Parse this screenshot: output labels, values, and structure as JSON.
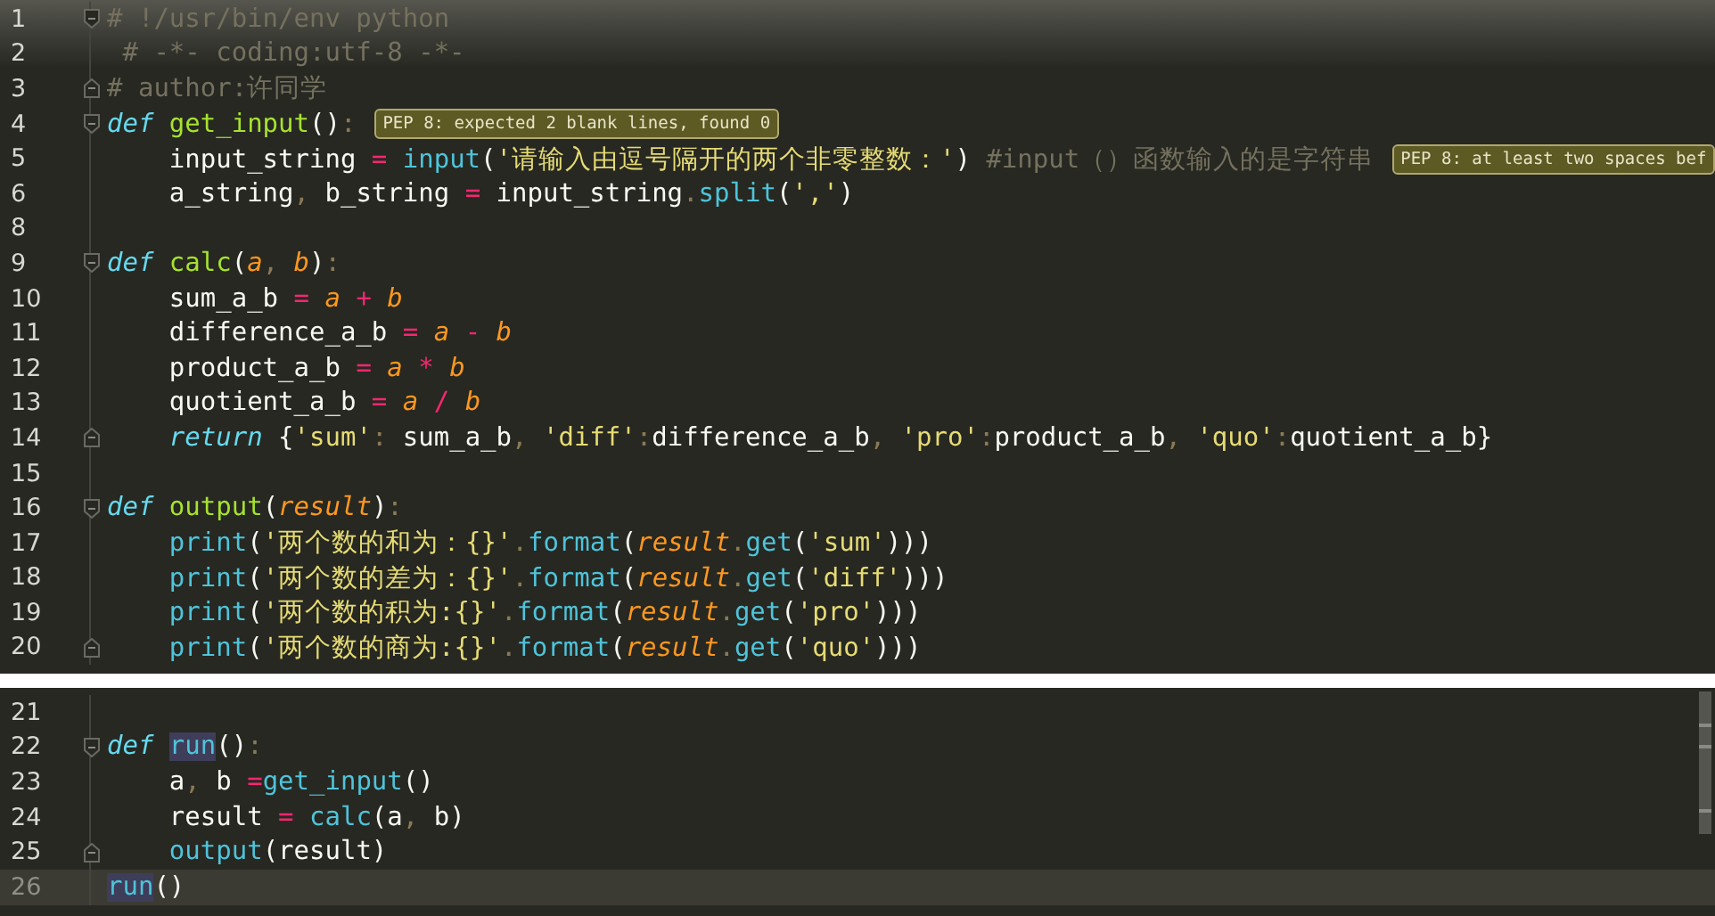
{
  "panels": [
    {
      "lines": [
        {
          "number": "1",
          "fold_marker": {
            "kind": "open"
          },
          "current": false,
          "tokens": [
            {
              "t": "# !/usr/bin/env python",
              "kind": "c"
            }
          ]
        },
        {
          "number": "2",
          "current": false,
          "tokens": [
            {
              "t": " # -*- coding:utf-8 -*-",
              "kind": "c"
            }
          ]
        },
        {
          "number": "3",
          "fold_marker": {
            "kind": "close"
          },
          "current": false,
          "tokens": [
            {
              "t": "# author:许同学",
              "kind": "c"
            }
          ]
        },
        {
          "number": "4",
          "fold_marker": {
            "kind": "open"
          },
          "current": false,
          "tokens": [
            {
              "t": "def ",
              "kind": "kw"
            },
            {
              "t": "get_input",
              "kind": "fn"
            },
            {
              "t": "()",
              "kind": "x"
            },
            {
              "t": ":",
              "kind": "p"
            }
          ],
          "hint": "PEP 8: expected 2 blank lines, found 0"
        },
        {
          "number": "5",
          "current": false,
          "tokens": [
            {
              "t": "    input_string ",
              "kind": "x"
            },
            {
              "t": "= ",
              "kind": "op"
            },
            {
              "t": "input",
              "kind": "call"
            },
            {
              "t": "(",
              "kind": "x"
            },
            {
              "t": "'请输入由逗号隔开的两个非零整数：'",
              "kind": "str"
            },
            {
              "t": ") ",
              "kind": "x"
            },
            {
              "t": "#input（）函数输入的是字符串",
              "kind": "c"
            }
          ],
          "hint": "PEP 8: at least two spaces bef"
        },
        {
          "number": "6",
          "current": false,
          "tokens": [
            {
              "t": "    a_string",
              "kind": "x"
            },
            {
              "t": ",",
              "kind": "p"
            },
            {
              "t": " b_string ",
              "kind": "x"
            },
            {
              "t": "=",
              "kind": "op"
            },
            {
              "t": " input_string",
              "kind": "x"
            },
            {
              "t": ".",
              "kind": "p"
            },
            {
              "t": "split",
              "kind": "call"
            },
            {
              "t": "(",
              "kind": "x"
            },
            {
              "t": "','",
              "kind": "str"
            },
            {
              "t": ")",
              "kind": "x"
            }
          ]
        },
        {
          "number": "8",
          "current": false
        },
        {
          "number": "9",
          "fold_marker": {
            "kind": "open"
          },
          "current": false,
          "tokens": [
            {
              "t": "def ",
              "kind": "kw"
            },
            {
              "t": "calc",
              "kind": "fn"
            },
            {
              "t": "(",
              "kind": "x"
            },
            {
              "t": "a",
              "kind": "par"
            },
            {
              "t": ", ",
              "kind": "p"
            },
            {
              "t": "b",
              "kind": "par"
            },
            {
              "t": ")",
              "kind": "x"
            },
            {
              "t": ":",
              "kind": "p"
            }
          ]
        },
        {
          "number": "10",
          "current": false,
          "tokens": [
            {
              "t": "    sum_a_b ",
              "kind": "x"
            },
            {
              "t": "= ",
              "kind": "op"
            },
            {
              "t": "a ",
              "kind": "par"
            },
            {
              "t": "+ ",
              "kind": "op"
            },
            {
              "t": "b",
              "kind": "par"
            }
          ]
        },
        {
          "number": "11",
          "current": false,
          "tokens": [
            {
              "t": "    difference_a_b ",
              "kind": "x"
            },
            {
              "t": "= ",
              "kind": "op"
            },
            {
              "t": "a ",
              "kind": "par"
            },
            {
              "t": "- ",
              "kind": "op"
            },
            {
              "t": "b",
              "kind": "par"
            }
          ]
        },
        {
          "number": "12",
          "current": false,
          "tokens": [
            {
              "t": "    product_a_b ",
              "kind": "x"
            },
            {
              "t": "= ",
              "kind": "op"
            },
            {
              "t": "a ",
              "kind": "par"
            },
            {
              "t": "* ",
              "kind": "op"
            },
            {
              "t": "b",
              "kind": "par"
            }
          ]
        },
        {
          "number": "13",
          "current": false,
          "tokens": [
            {
              "t": "    quotient_a_b ",
              "kind": "x"
            },
            {
              "t": "= ",
              "kind": "op"
            },
            {
              "t": "a ",
              "kind": "par"
            },
            {
              "t": "/ ",
              "kind": "op"
            },
            {
              "t": "b",
              "kind": "par"
            }
          ]
        },
        {
          "number": "14",
          "fold_marker": {
            "kind": "close"
          },
          "current": false,
          "tokens": [
            {
              "t": "    return",
              "kind": "kw"
            },
            {
              "t": " {",
              "kind": "x"
            },
            {
              "t": "'sum'",
              "kind": "str"
            },
            {
              "t": ":",
              "kind": "p"
            },
            {
              "t": " sum_a_b",
              "kind": "x"
            },
            {
              "t": ", ",
              "kind": "p"
            },
            {
              "t": "'diff'",
              "kind": "str"
            },
            {
              "t": ":",
              "kind": "p"
            },
            {
              "t": "difference_a_b",
              "kind": "x"
            },
            {
              "t": ", ",
              "kind": "p"
            },
            {
              "t": "'pro'",
              "kind": "str"
            },
            {
              "t": ":",
              "kind": "p"
            },
            {
              "t": "product_a_b",
              "kind": "x"
            },
            {
              "t": ", ",
              "kind": "p"
            },
            {
              "t": "'quo'",
              "kind": "str"
            },
            {
              "t": ":",
              "kind": "p"
            },
            {
              "t": "quotient_a_b}",
              "kind": "x"
            }
          ]
        },
        {
          "number": "15",
          "current": false
        },
        {
          "number": "16",
          "fold_marker": {
            "kind": "open"
          },
          "current": false,
          "tokens": [
            {
              "t": "def ",
              "kind": "kw"
            },
            {
              "t": "output",
              "kind": "fn"
            },
            {
              "t": "(",
              "kind": "x"
            },
            {
              "t": "result",
              "kind": "par"
            },
            {
              "t": ")",
              "kind": "x"
            },
            {
              "t": ":",
              "kind": "p"
            }
          ]
        },
        {
          "number": "17",
          "current": false,
          "tokens": [
            {
              "t": "    print",
              "kind": "call"
            },
            {
              "t": "(",
              "kind": "x"
            },
            {
              "t": "'两个数的和为：{}'",
              "kind": "str"
            },
            {
              "t": ".",
              "kind": "p"
            },
            {
              "t": "format",
              "kind": "call"
            },
            {
              "t": "(",
              "kind": "x"
            },
            {
              "t": "result",
              "kind": "par"
            },
            {
              "t": ".",
              "kind": "p"
            },
            {
              "t": "get",
              "kind": "call"
            },
            {
              "t": "(",
              "kind": "x"
            },
            {
              "t": "'sum'",
              "kind": "str"
            },
            {
              "t": ")))",
              "kind": "x"
            }
          ]
        },
        {
          "number": "18",
          "current": false,
          "tokens": [
            {
              "t": "    print",
              "kind": "call"
            },
            {
              "t": "(",
              "kind": "x"
            },
            {
              "t": "'两个数的差为：{}'",
              "kind": "str"
            },
            {
              "t": ".",
              "kind": "p"
            },
            {
              "t": "format",
              "kind": "call"
            },
            {
              "t": "(",
              "kind": "x"
            },
            {
              "t": "result",
              "kind": "par"
            },
            {
              "t": ".",
              "kind": "p"
            },
            {
              "t": "get",
              "kind": "call"
            },
            {
              "t": "(",
              "kind": "x"
            },
            {
              "t": "'diff'",
              "kind": "str"
            },
            {
              "t": ")))",
              "kind": "x"
            }
          ]
        },
        {
          "number": "19",
          "current": false,
          "tokens": [
            {
              "t": "    print",
              "kind": "call"
            },
            {
              "t": "(",
              "kind": "x"
            },
            {
              "t": "'两个数的积为:{}'",
              "kind": "str"
            },
            {
              "t": ".",
              "kind": "p"
            },
            {
              "t": "format",
              "kind": "call"
            },
            {
              "t": "(",
              "kind": "x"
            },
            {
              "t": "result",
              "kind": "par"
            },
            {
              "t": ".",
              "kind": "p"
            },
            {
              "t": "get",
              "kind": "call"
            },
            {
              "t": "(",
              "kind": "x"
            },
            {
              "t": "'pro'",
              "kind": "str"
            },
            {
              "t": ")))",
              "kind": "x"
            }
          ]
        },
        {
          "number": "20",
          "fold_marker": {
            "kind": "close"
          },
          "current": false,
          "tokens": [
            {
              "t": "    print",
              "kind": "call"
            },
            {
              "t": "(",
              "kind": "x"
            },
            {
              "t": "'两个数的商为:{}'",
              "kind": "str"
            },
            {
              "t": ".",
              "kind": "p"
            },
            {
              "t": "format",
              "kind": "call"
            },
            {
              "t": "(",
              "kind": "x"
            },
            {
              "t": "result",
              "kind": "par"
            },
            {
              "t": ".",
              "kind": "p"
            },
            {
              "t": "get",
              "kind": "call"
            },
            {
              "t": "(",
              "kind": "x"
            },
            {
              "t": "'quo'",
              "kind": "str"
            },
            {
              "t": ")))",
              "kind": "x"
            }
          ]
        }
      ]
    },
    {
      "lines": [
        {
          "number": "21",
          "current": false
        },
        {
          "number": "22",
          "fold_marker": {
            "kind": "open"
          },
          "current": false,
          "tokens": [
            {
              "t": "def ",
              "kind": "kw"
            },
            {
              "t": "run",
              "kind": "hl"
            },
            {
              "t": "()",
              "kind": "x"
            },
            {
              "t": ":",
              "kind": "p"
            }
          ]
        },
        {
          "number": "23",
          "current": false,
          "tokens": [
            {
              "t": "    a",
              "kind": "x"
            },
            {
              "t": ",",
              "kind": "p"
            },
            {
              "t": " b ",
              "kind": "x"
            },
            {
              "t": "=",
              "kind": "op"
            },
            {
              "t": "get_input",
              "kind": "call"
            },
            {
              "t": "()",
              "kind": "x"
            }
          ]
        },
        {
          "number": "24",
          "current": false,
          "tokens": [
            {
              "t": "    result ",
              "kind": "x"
            },
            {
              "t": "= ",
              "kind": "op"
            },
            {
              "t": "calc",
              "kind": "call"
            },
            {
              "t": "(a",
              "kind": "x"
            },
            {
              "t": ", ",
              "kind": "p"
            },
            {
              "t": "b)",
              "kind": "x"
            }
          ]
        },
        {
          "number": "25",
          "fold_marker": {
            "kind": "close"
          },
          "current": false,
          "tokens": [
            {
              "t": "    output",
              "kind": "call"
            },
            {
              "t": "(result)",
              "kind": "x"
            }
          ]
        },
        {
          "number": "26",
          "current": true,
          "tokens": [
            {
              "t": "run",
              "kind": "hl"
            },
            {
              "t": "()",
              "kind": "x"
            }
          ]
        }
      ]
    }
  ]
}
